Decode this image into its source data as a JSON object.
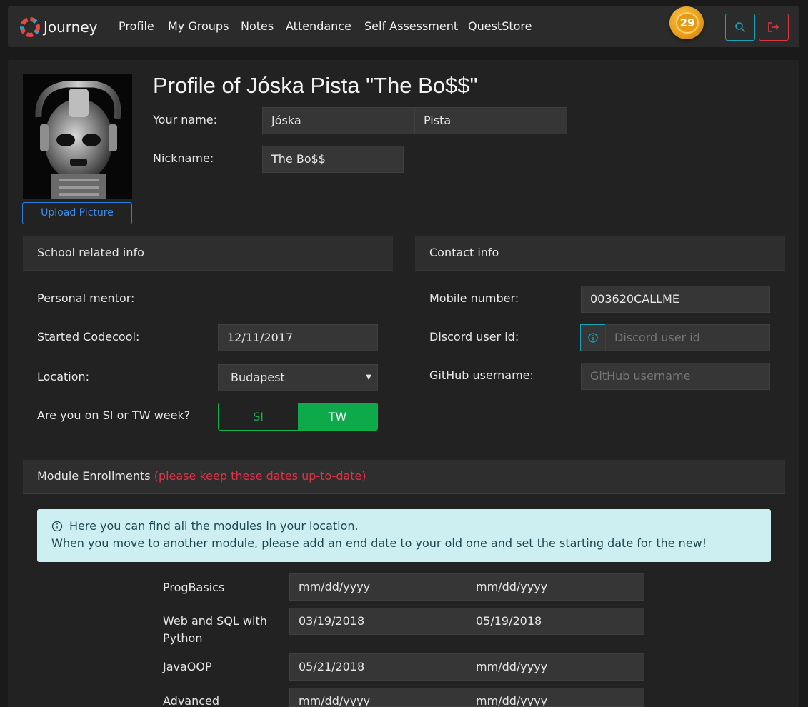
{
  "nav": {
    "brand": "Journey",
    "links": [
      "Profile",
      "My Groups",
      "Notes",
      "Attendance",
      "Self Assessment",
      "QuestStore"
    ],
    "coins": "29"
  },
  "profile": {
    "title": "Profile of Jóska Pista \"The Bo$$\"",
    "upload_label": "Upload Picture",
    "name_label": "Your name:",
    "first_name": "Jóska",
    "last_name": "Pista",
    "nickname_label": "Nickname:",
    "nickname": "The Bo$$"
  },
  "school": {
    "header": "School related info",
    "mentor_label": "Personal mentor:",
    "started_label": "Started Codecool:",
    "started_value": "12/11/2017",
    "location_label": "Location:",
    "location_value": "Budapest",
    "week_label": "Are you on SI or TW week?",
    "week_options": [
      "SI",
      "TW"
    ],
    "week_selected": "TW"
  },
  "contact": {
    "header": "Contact info",
    "mobile_label": "Mobile number:",
    "mobile_value": "003620CALLME",
    "discord_label": "Discord user id:",
    "discord_placeholder": "Discord user id",
    "github_label": "GitHub username:",
    "github_placeholder": "GitHub username"
  },
  "modules": {
    "header": "Module Enrollments",
    "header_warning": "(please keep these dates up-to-date)",
    "info_line1": "Here you can find all the modules in your location.",
    "info_line2": "When you move to another module, please add an end date to your old one and set the starting date for the new!",
    "rows": [
      {
        "name": "ProgBasics",
        "start": "mm/dd/yyyy",
        "end": "mm/dd/yyyy"
      },
      {
        "name": "Web and SQL with Python",
        "start": "03/19/2018",
        "end": "05/19/2018"
      },
      {
        "name": "JavaOOP",
        "start": "05/21/2018",
        "end": "mm/dd/yyyy"
      },
      {
        "name": "Advanced",
        "start": "mm/dd/yyyy",
        "end": "mm/dd/yyyy"
      }
    ]
  },
  "colors": {
    "accent_teal": "#17a2b8",
    "danger": "#dc3545",
    "success": "#0ea94a",
    "coin": "#e89c1a"
  }
}
